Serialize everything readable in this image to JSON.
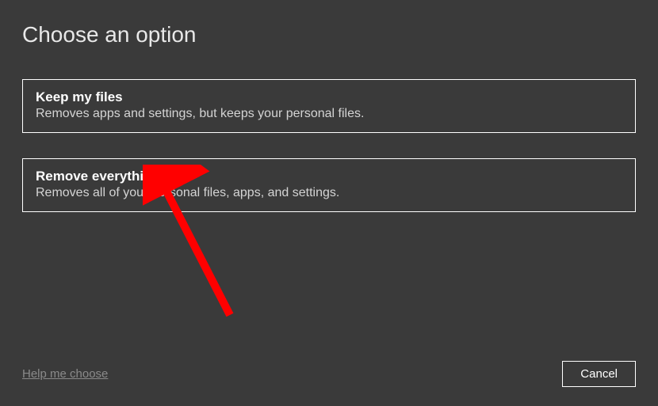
{
  "heading": "Choose an option",
  "options": [
    {
      "title": "Keep my files",
      "description": "Removes apps and settings, but keeps your personal files."
    },
    {
      "title": "Remove everything",
      "description": "Removes all of your personal files, apps, and settings."
    }
  ],
  "help_link": "Help me choose",
  "cancel_button": "Cancel"
}
